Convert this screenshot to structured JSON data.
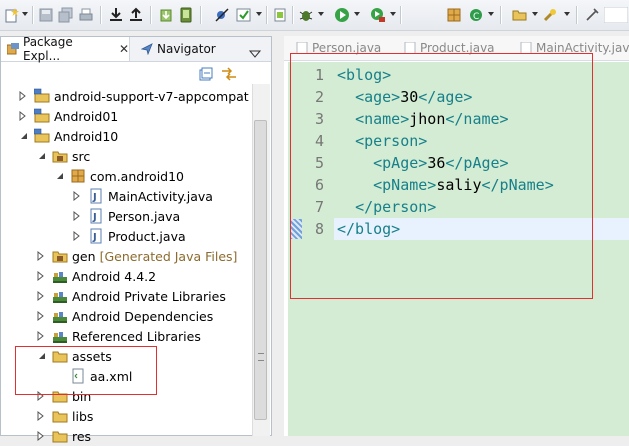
{
  "explorer": {
    "tab_package": "Package Expl...",
    "tab_navigator": "Navigator",
    "close": "✕"
  },
  "tree": [
    {
      "name": "android-support-v7-appcompat",
      "indent": 0,
      "twisty": "closed",
      "icon": "project-icon"
    },
    {
      "name": "Android01",
      "indent": 0,
      "twisty": "closed",
      "icon": "project-icon"
    },
    {
      "name": "Android10",
      "indent": 0,
      "twisty": "open",
      "icon": "project-icon"
    },
    {
      "name": "src",
      "indent": 1,
      "twisty": "open",
      "icon": "source-folder-icon"
    },
    {
      "name": "com.android10",
      "indent": 2,
      "twisty": "open",
      "icon": "package-icon"
    },
    {
      "name": "MainActivity.java",
      "indent": 3,
      "twisty": "closed",
      "icon": "java-file-icon"
    },
    {
      "name": "Person.java",
      "indent": 3,
      "twisty": "closed",
      "icon": "java-file-icon"
    },
    {
      "name": "Product.java",
      "indent": 3,
      "twisty": "closed",
      "icon": "java-file-icon"
    },
    {
      "name": "gen",
      "decoration": "[Generated Java Files]",
      "indent": 1,
      "twisty": "closed",
      "icon": "source-folder-icon"
    },
    {
      "name": "Android 4.4.2",
      "indent": 1,
      "twisty": "closed",
      "icon": "library-icon"
    },
    {
      "name": "Android Private Libraries",
      "indent": 1,
      "twisty": "closed",
      "icon": "library-icon"
    },
    {
      "name": "Android Dependencies",
      "indent": 1,
      "twisty": "closed",
      "icon": "library-icon"
    },
    {
      "name": "Referenced Libraries",
      "indent": 1,
      "twisty": "closed",
      "icon": "library-icon"
    },
    {
      "name": "assets",
      "indent": 1,
      "twisty": "open",
      "icon": "folder-icon"
    },
    {
      "name": "aa.xml",
      "indent": 2,
      "twisty": "none",
      "icon": "xml-file-icon"
    },
    {
      "name": "bin",
      "indent": 1,
      "twisty": "closed",
      "icon": "folder-icon"
    },
    {
      "name": "libs",
      "indent": 1,
      "twisty": "closed",
      "icon": "folder-icon"
    },
    {
      "name": "res",
      "indent": 1,
      "twisty": "closed",
      "icon": "folder-icon"
    }
  ],
  "editor": {
    "tabs": [
      "Person.java",
      "Product.java",
      "MainActivity.java"
    ],
    "lines": [
      {
        "no": "1",
        "indent": "",
        "parts": [
          [
            "t",
            "<blog>"
          ]
        ]
      },
      {
        "no": "2",
        "indent": "  ",
        "parts": [
          [
            "t",
            "<age>"
          ],
          [
            "v",
            "30"
          ],
          [
            "t",
            "</age>"
          ]
        ]
      },
      {
        "no": "3",
        "indent": "  ",
        "parts": [
          [
            "t",
            "<name>"
          ],
          [
            "v",
            "jhon"
          ],
          [
            "t",
            "</name>"
          ]
        ]
      },
      {
        "no": "4",
        "indent": "  ",
        "parts": [
          [
            "t",
            "<person>"
          ]
        ]
      },
      {
        "no": "5",
        "indent": "    ",
        "parts": [
          [
            "t",
            "<pAge>"
          ],
          [
            "v",
            "36"
          ],
          [
            "t",
            "</pAge>"
          ]
        ]
      },
      {
        "no": "6",
        "indent": "    ",
        "parts": [
          [
            "t",
            "<pName>"
          ],
          [
            "v",
            "saliy"
          ],
          [
            "t",
            "</pName>"
          ]
        ]
      },
      {
        "no": "7",
        "indent": "  ",
        "parts": [
          [
            "t",
            "</person>"
          ]
        ]
      },
      {
        "no": "8",
        "indent": "",
        "parts": [
          [
            "t",
            "</blog>"
          ]
        ]
      }
    ],
    "current_line": 8
  },
  "colors": {
    "code_background": "#d4ecd4",
    "tag_color": "#17808a",
    "annotation_red": "#e03030",
    "current_line": "#e8f2fe"
  }
}
